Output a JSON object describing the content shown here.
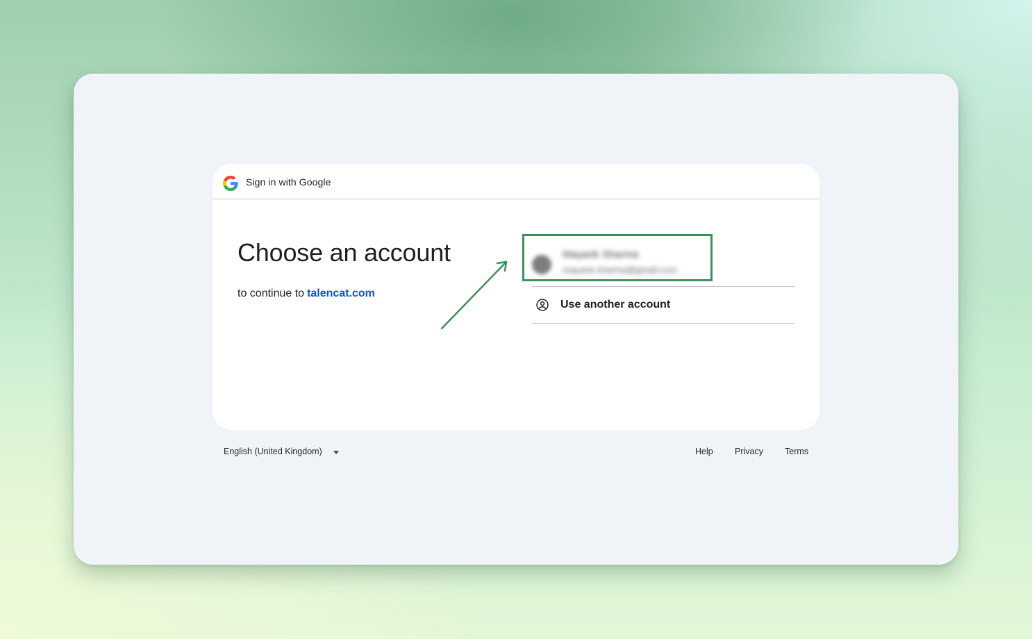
{
  "header": {
    "title": "Sign in with Google",
    "logo_icon": "google-g-logo"
  },
  "main": {
    "heading": "Choose an account",
    "subtitle_prefix": "to continue to",
    "site_link": "talencat.com"
  },
  "accounts": [
    {
      "name": "Mayank Sharma",
      "email": "mayank.sharma@gmail.com",
      "blurred": true,
      "highlighted": true
    }
  ],
  "use_another": {
    "label": "Use another account",
    "icon": "account-circle-icon"
  },
  "footer": {
    "language": "English (United Kingdom)",
    "links": [
      "Help",
      "Privacy",
      "Terms"
    ]
  },
  "annotation": {
    "highlight_color": "#3d8f5d",
    "arrow_color": "#3d8f5d"
  },
  "colors": {
    "link_blue": "#0b57d0",
    "text": "#1f1f1f",
    "window_bg": "#f0f4f9"
  }
}
